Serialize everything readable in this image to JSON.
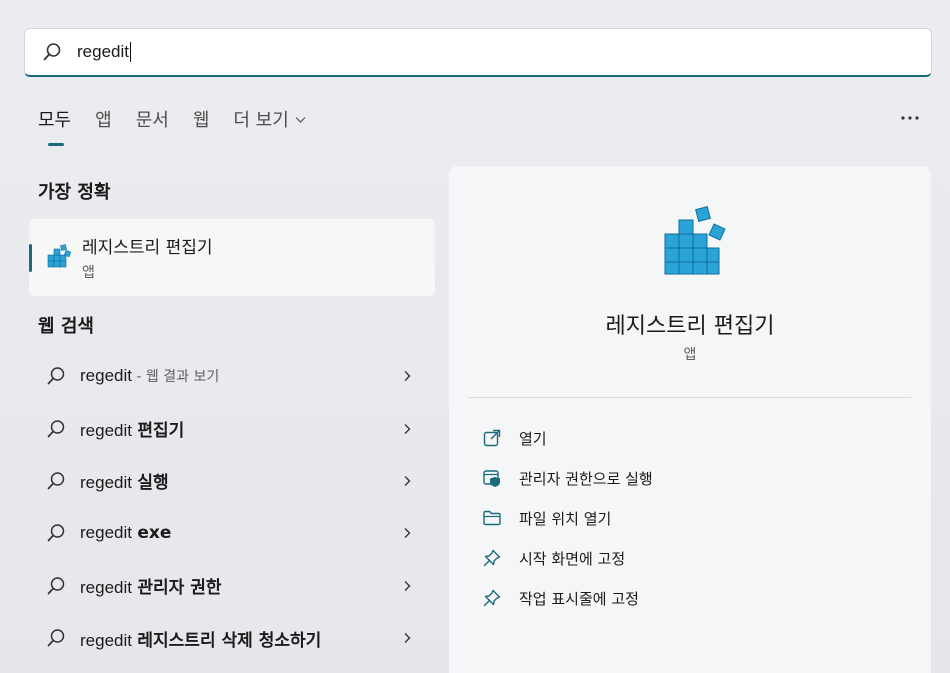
{
  "search": {
    "query": "regedit"
  },
  "tabs": [
    {
      "label": "모두"
    },
    {
      "label": "앱"
    },
    {
      "label": "문서"
    },
    {
      "label": "웹"
    },
    {
      "label": "더 보기"
    }
  ],
  "best_match": {
    "heading": "가장 정확",
    "name": "레지스트리 편집기",
    "type": "앱"
  },
  "web_search": {
    "heading": "웹 검색",
    "items": [
      {
        "query": "regedit",
        "suffix": " - 웹 결과 보기",
        "bold": ""
      },
      {
        "query": "regedit",
        "suffix": "",
        "bold": "편집기"
      },
      {
        "query": "regedit",
        "suffix": "",
        "bold": "실행"
      },
      {
        "query": "regedit",
        "suffix": "",
        "bold": "exe"
      },
      {
        "query": "regedit",
        "suffix": "",
        "bold": "관리자 권한"
      },
      {
        "query": "regedit",
        "suffix": "",
        "bold": "레지스트리 삭제 청소하기"
      }
    ]
  },
  "detail": {
    "name": "레지스트리 편집기",
    "type": "앱",
    "actions": [
      {
        "label": "열기",
        "icon": "open-external-icon"
      },
      {
        "label": "관리자 권한으로 실행",
        "icon": "admin-shield-icon"
      },
      {
        "label": "파일 위치 열기",
        "icon": "folder-icon"
      },
      {
        "label": "시작 화면에 고정",
        "icon": "pin-icon"
      },
      {
        "label": "작업 표시줄에 고정",
        "icon": "pin-icon"
      }
    ]
  },
  "colors": {
    "accent": "#1a6a7c",
    "cube": "#2aa3d8"
  }
}
